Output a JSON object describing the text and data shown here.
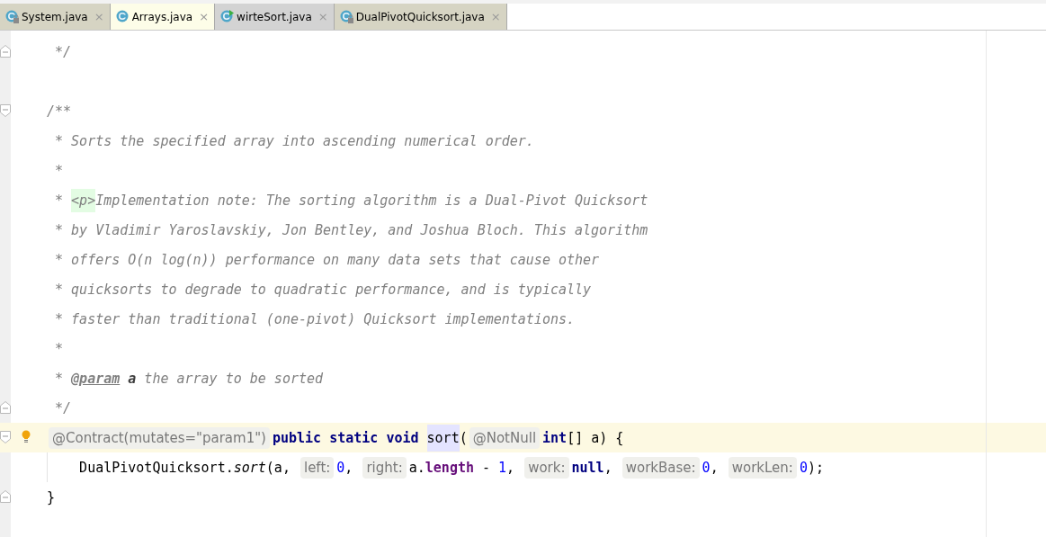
{
  "tabs": [
    {
      "label": "System.java",
      "selected": false,
      "kind": "locked",
      "close": "×"
    },
    {
      "label": "Arrays.java",
      "selected": true,
      "kind": "plain",
      "close": "×"
    },
    {
      "label": "wirteSort.java",
      "selected": false,
      "kind": "runnable",
      "close": "×"
    },
    {
      "label": "DualPivotQuicksort.java",
      "selected": false,
      "kind": "locked",
      "close": "×"
    }
  ],
  "editor": {
    "lines": [
      {
        "kind": "code",
        "fold_end": true,
        "tokens": [
          {
            "kind": "comment",
            "text": " */"
          }
        ]
      },
      {
        "kind": "blank"
      },
      {
        "kind": "code",
        "fold_start": true,
        "tokens": [
          {
            "kind": "comment",
            "text": "/**"
          }
        ]
      },
      {
        "kind": "code",
        "tokens": [
          {
            "kind": "comment",
            "text": " * Sorts the specified array into ascending numerical order."
          }
        ]
      },
      {
        "kind": "code",
        "tokens": [
          {
            "kind": "comment",
            "text": " *"
          }
        ]
      },
      {
        "kind": "code",
        "tokens": [
          {
            "kind": "comment",
            "text": " * "
          },
          {
            "kind": "doc_tag",
            "text": "<p>"
          },
          {
            "kind": "comment",
            "text": "Implementation note: The sorting algorithm is a Dual-Pivot Quicksort"
          }
        ]
      },
      {
        "kind": "code",
        "tokens": [
          {
            "kind": "comment",
            "text": " * by Vladimir Yaroslavskiy, Jon Bentley, and Joshua Bloch. This algorithm"
          }
        ]
      },
      {
        "kind": "code",
        "tokens": [
          {
            "kind": "comment",
            "text": " * offers O(n log(n)) performance on many data sets that cause other"
          }
        ]
      },
      {
        "kind": "code",
        "tokens": [
          {
            "kind": "comment",
            "text": " * quicksorts to degrade to quadratic performance, and is typically"
          }
        ]
      },
      {
        "kind": "code",
        "tokens": [
          {
            "kind": "comment",
            "text": " * faster than traditional (one-pivot) Quicksort implementations."
          }
        ]
      },
      {
        "kind": "code",
        "tokens": [
          {
            "kind": "comment",
            "text": " *"
          }
        ]
      },
      {
        "kind": "code",
        "tokens": [
          {
            "kind": "comment",
            "text": " * "
          },
          {
            "kind": "doc_at",
            "text": "@param"
          },
          {
            "kind": "doc_param",
            "text": " a"
          },
          {
            "kind": "comment",
            "text": " the array to be sorted"
          }
        ]
      },
      {
        "kind": "code",
        "fold_end": true,
        "tokens": [
          {
            "kind": "comment",
            "text": " */"
          }
        ]
      },
      {
        "kind": "code",
        "fold_start": true,
        "current": true,
        "bulb": true,
        "tokens": [
          {
            "kind": "hint",
            "text": "@Contract(mutates=\"param1\")"
          },
          {
            "kind": "keyword",
            "text": "public static void "
          },
          {
            "kind": "usage",
            "text": "sort"
          },
          {
            "kind": "plain",
            "text": "("
          },
          {
            "kind": "hint",
            "text": "@NotNull"
          },
          {
            "kind": "keyword",
            "text": "int"
          },
          {
            "kind": "plain",
            "text": "[] a) {"
          }
        ]
      },
      {
        "kind": "code",
        "guide": true,
        "tokens": [
          {
            "kind": "plain",
            "text": "    DualPivotQuicksort."
          },
          {
            "kind": "static_call",
            "text": "sort"
          },
          {
            "kind": "plain",
            "text": "(a, "
          },
          {
            "kind": "hint",
            "text": "left:"
          },
          {
            "kind": "number",
            "text": "0"
          },
          {
            "kind": "plain",
            "text": ", "
          },
          {
            "kind": "hint",
            "text": "right:"
          },
          {
            "kind": "plain",
            "text": "a."
          },
          {
            "kind": "field",
            "text": "length"
          },
          {
            "kind": "plain",
            "text": " - "
          },
          {
            "kind": "number",
            "text": "1"
          },
          {
            "kind": "plain",
            "text": ", "
          },
          {
            "kind": "hint",
            "text": "work:"
          },
          {
            "kind": "keyword",
            "text": "null"
          },
          {
            "kind": "plain",
            "text": ", "
          },
          {
            "kind": "hint",
            "text": "workBase:"
          },
          {
            "kind": "number",
            "text": "0"
          },
          {
            "kind": "plain",
            "text": ", "
          },
          {
            "kind": "hint",
            "text": "workLen:"
          },
          {
            "kind": "number",
            "text": "0"
          },
          {
            "kind": "plain",
            "text": ");"
          }
        ]
      },
      {
        "kind": "code",
        "fold_end": true,
        "tokens": [
          {
            "kind": "plain",
            "text": "}"
          }
        ]
      }
    ]
  }
}
